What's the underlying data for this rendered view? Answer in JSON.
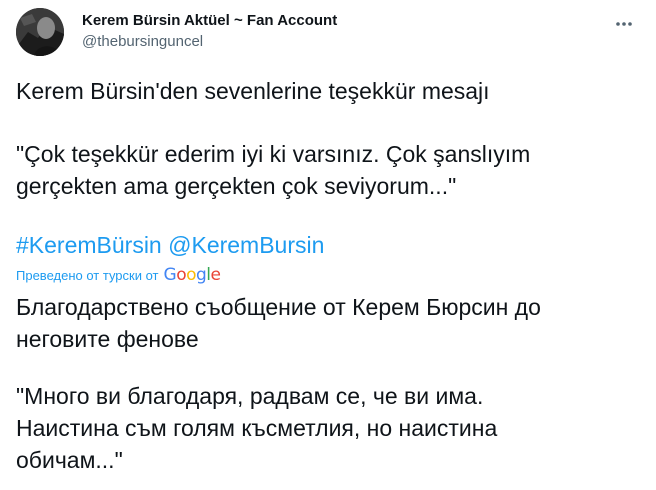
{
  "tweet": {
    "author_name": "Kerem Bürsin Aktüel ~ Fan Account",
    "author_handle": "@thebursinguncel",
    "text_line_1": "Kerem Bürsin'den sevenlerine teşekkür mesajı",
    "text_line_2": "\"Çok teşekkür ederim iyi ki varsınız. Çok şanslıyım",
    "text_line_3": "gerçekten ama gerçekten çok seviyorum...\"",
    "hashtag": "#KeremBürsin",
    "mention": "@KeremBursin"
  },
  "translation": {
    "label": "Преведено от турски от",
    "provider": {
      "letters": [
        "G",
        "o",
        "o",
        "g",
        "l",
        "e"
      ],
      "colors": [
        "#4285F4",
        "#EA4335",
        "#FBBC05",
        "#4285F4",
        "#34A853",
        "#EA4335"
      ]
    },
    "line_1": "Благодарствено съобщение от Керем Бюрсин до",
    "line_2": "неговите фенове",
    "line_3": "\"Много ви благодаря, радвам се, че ви има.",
    "line_4": "Наистина съм голям късметлия, но наистина",
    "line_5": "обичам...\""
  },
  "icons": {
    "more": "more-horizontal-icon",
    "avatar": "profile-photo"
  },
  "colors": {
    "link": "#1d9bf0",
    "secondary": "#536471",
    "text": "#0f1419"
  }
}
